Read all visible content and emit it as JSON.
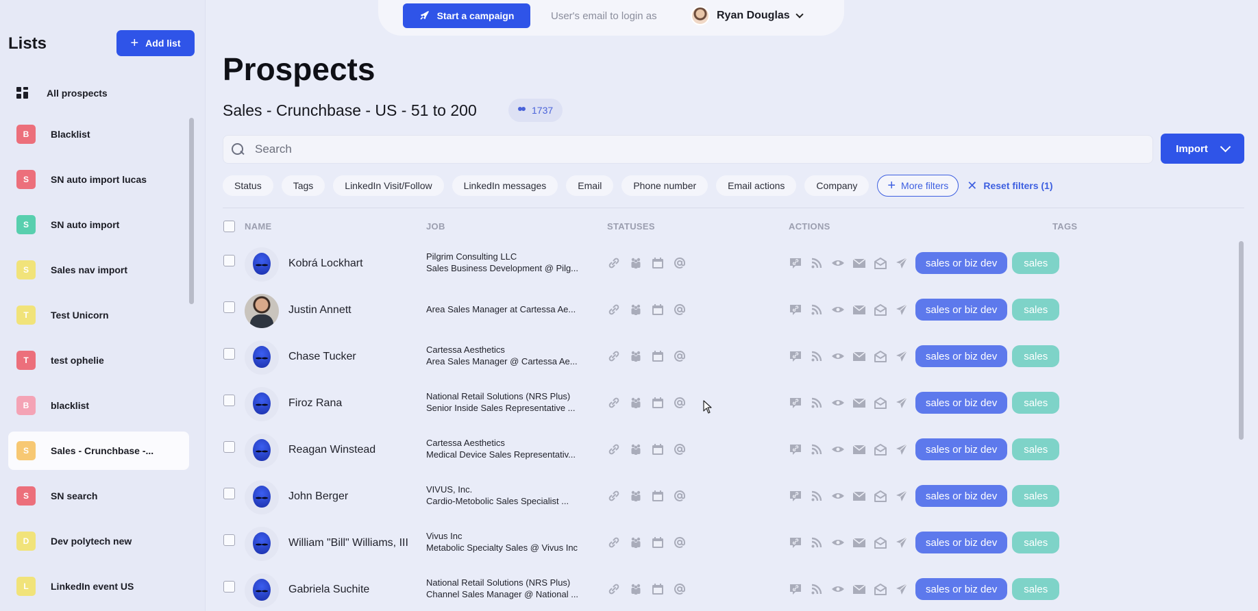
{
  "sidebar": {
    "title": "Lists",
    "add_list_label": "Add list",
    "all_prospects_label": "All prospects",
    "items": [
      {
        "letter": "B",
        "label": "Blacklist",
        "color": "#ec6f7b"
      },
      {
        "letter": "S",
        "label": "SN auto import lucas",
        "color": "#ec6f7b"
      },
      {
        "letter": "S",
        "label": "SN auto import",
        "color": "#58cfae"
      },
      {
        "letter": "S",
        "label": "Sales nav import",
        "color": "#f1e37a"
      },
      {
        "letter": "T",
        "label": "Test Unicorn",
        "color": "#f1e37a"
      },
      {
        "letter": "T",
        "label": "test ophelie",
        "color": "#ec6f7b"
      },
      {
        "letter": "B",
        "label": "blacklist",
        "color": "#f4a3b5"
      },
      {
        "letter": "S",
        "label": "Sales - Crunchbase -...",
        "color": "#f7c873",
        "active": true
      },
      {
        "letter": "S",
        "label": "SN search",
        "color": "#ec6f7b"
      },
      {
        "letter": "D",
        "label": "Dev polytech new",
        "color": "#f1e37a"
      },
      {
        "letter": "L",
        "label": "LinkedIn event US",
        "color": "#f1e37a"
      }
    ]
  },
  "topbar": {
    "campaign_label": "Start a campaign",
    "login_as_text": "User's email to login as",
    "user_name": "Ryan Douglas"
  },
  "main": {
    "title": "Prospects",
    "list_name": "Sales - Crunchbase - US - 51 to 200",
    "count": "1737",
    "search_placeholder": "Search",
    "import_label": "Import",
    "filters": [
      "Status",
      "Tags",
      "LinkedIn Visit/Follow",
      "LinkedIn messages",
      "Email",
      "Phone number",
      "Email actions",
      "Company"
    ],
    "more_filters_label": "More filters",
    "reset_filters_label": "Reset filters (1)"
  },
  "table": {
    "headers": {
      "name": "NAME",
      "job": "JOB",
      "statuses": "STATUSES",
      "actions": "ACTIONS",
      "tags": "TAGS"
    },
    "rows": [
      {
        "name": "Kobrá Lockhart",
        "job1": "Pilgrim Consulting LLC",
        "job2": "Sales Business Development @ Pilg...",
        "avatar": "alien",
        "tags": [
          "sales or biz dev",
          "sales"
        ]
      },
      {
        "name": "Justin Annett",
        "job1": "Area Sales Manager at Cartessa Ae...",
        "job2": "",
        "avatar": "photo",
        "tags": [
          "sales or biz dev",
          "sales"
        ]
      },
      {
        "name": "Chase Tucker",
        "job1": "Cartessa Aesthetics",
        "job2": "Area Sales Manager @ Cartessa Ae...",
        "avatar": "alien",
        "tags": [
          "sales or biz dev",
          "sales"
        ]
      },
      {
        "name": "Firoz Rana",
        "job1": "National Retail Solutions (NRS Plus)",
        "job2": "Senior Inside Sales Representative ...",
        "avatar": "alien",
        "tags": [
          "sales or biz dev",
          "sales"
        ]
      },
      {
        "name": "Reagan Winstead",
        "job1": "Cartessa Aesthetics",
        "job2": "Medical Device Sales Representativ...",
        "avatar": "alien",
        "tags": [
          "sales or biz dev",
          "sales"
        ]
      },
      {
        "name": "John Berger",
        "job1": "VIVUS, Inc.",
        "job2": "Cardio-Metobolic Sales Specialist ...",
        "avatar": "alien",
        "tags": [
          "sales or biz dev",
          "sales"
        ]
      },
      {
        "name": "William \"Bill\" Williams, III",
        "job1": "Vivus Inc",
        "job2": "Metabolic Specialty Sales @ Vivus Inc",
        "avatar": "alien",
        "tags": [
          "sales or biz dev",
          "sales"
        ]
      },
      {
        "name": "Gabriela Suchite",
        "job1": "National Retail Solutions (NRS Plus)",
        "job2": "Channel Sales Manager @ National ...",
        "avatar": "alien",
        "tags": [
          "sales or biz dev",
          "sales"
        ]
      }
    ]
  }
}
